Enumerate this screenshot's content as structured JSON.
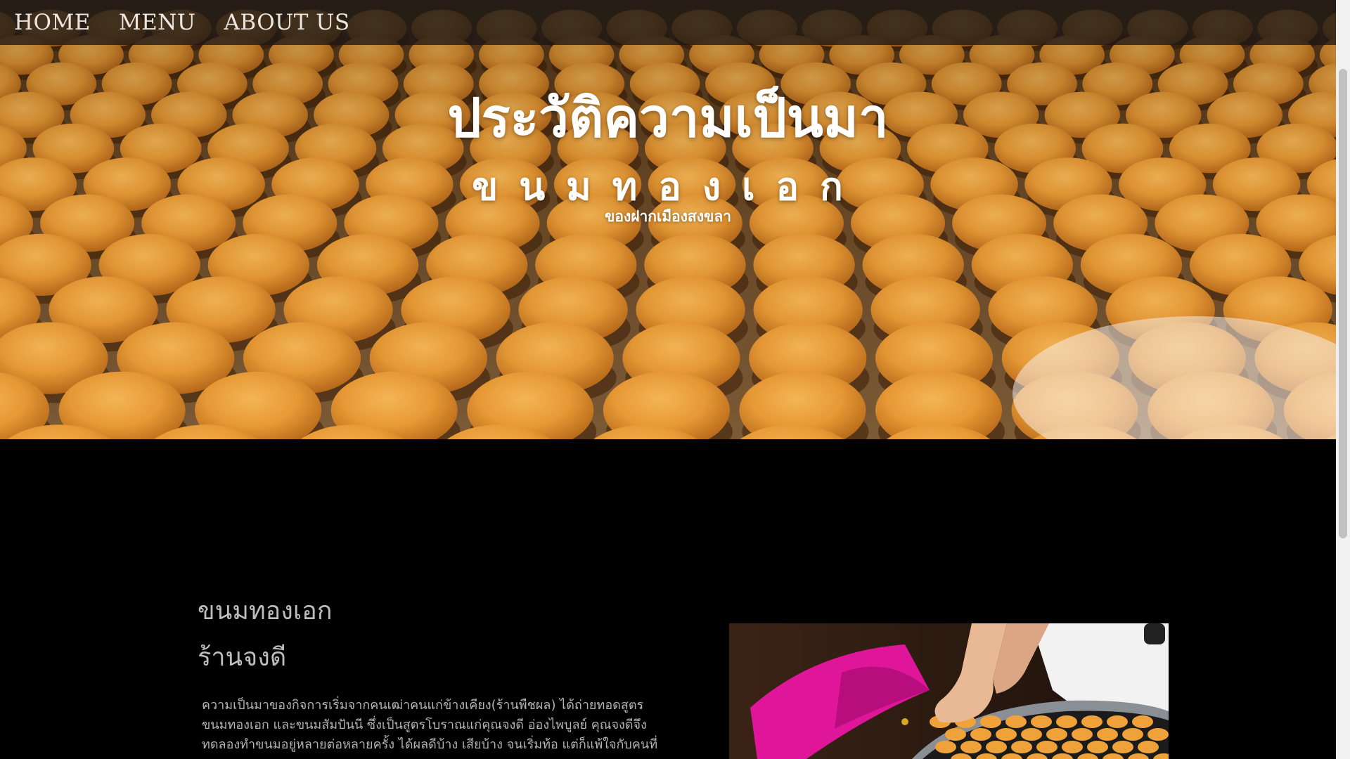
{
  "nav": {
    "items": [
      {
        "label": "HOME"
      },
      {
        "label": "MENU"
      },
      {
        "label": "ABOUT US"
      }
    ]
  },
  "hero": {
    "title": "ประวัติความเป็นมา",
    "subtitle": "ขนมทองเอก",
    "tagline": "ของฝากเมืองสงขลา",
    "background_color": "#b8701c"
  },
  "section": {
    "product_heading": "ขนมทองเอก",
    "shop_heading": "ร้านจงดี",
    "paragraph": "ความเป็นมาของกิจการเริ่มจากคนเฒ่าคนแก่ข้างเคียง(ร้านพืชผล) ได้ถ่ายทอดสูตรขนมทองเอก และขนมสัมปันนี ซึ่งเป็นสูตรโบราณแก่คุณจงดี อ่องไพบูลย์ คุณจงดีจึงทดลองทำขนมอยู่หลายต่อหลายครั้ง ได้ผลดีบ้าง เสียบ้าง จนเริ่มท้อ แต่ก็แพ้ใจกับคนที่มอบ"
  },
  "colors": {
    "page_background": "#000000",
    "nav_background": "rgba(30,24,22,0.78)",
    "heading_gray": "#bdbdbd",
    "text_gray": "#b3b3b3",
    "dessert_orange": "#e89a35",
    "basin_pink": "#e0169a"
  }
}
